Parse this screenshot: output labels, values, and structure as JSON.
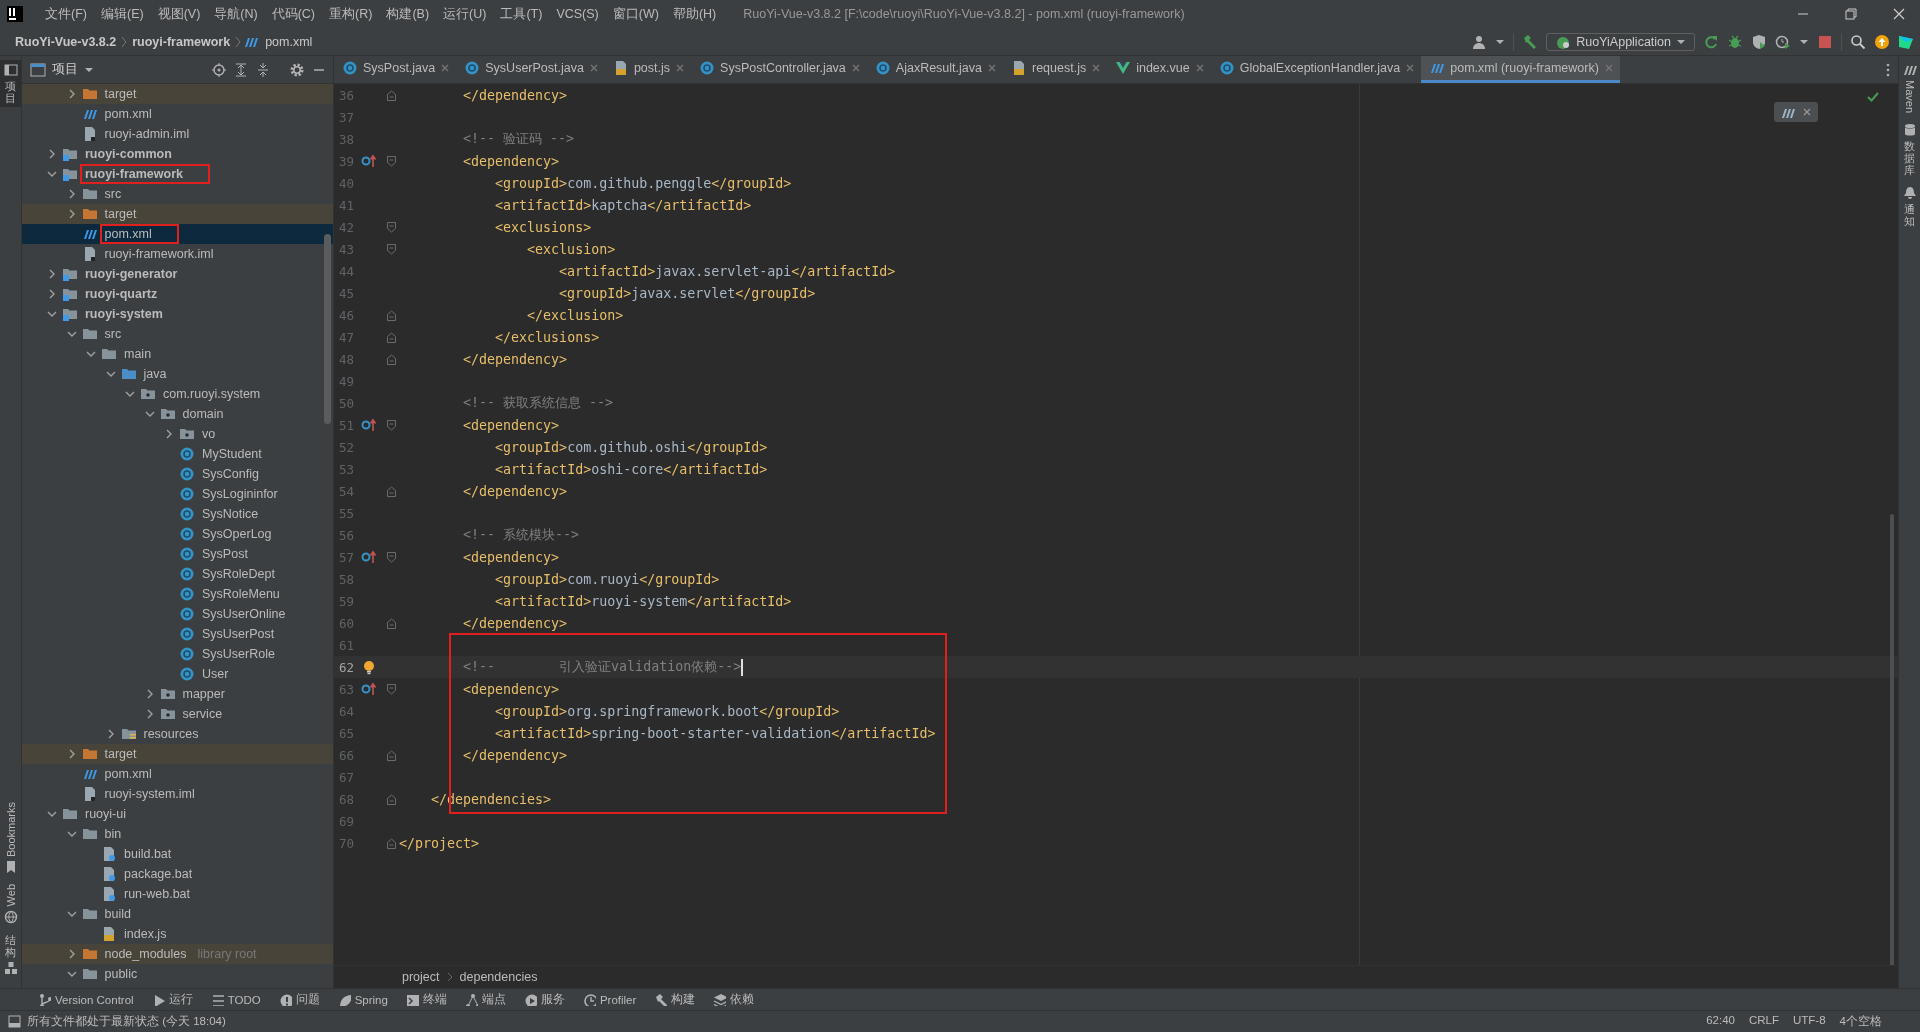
{
  "window_title": "RuoYi-Vue-v3.8.2 [F:\\code\\ruoyi\\RuoYi-Vue-v3.8.2] - pom.xml (ruoyi-framework)",
  "menu": [
    "文件(F)",
    "编辑(E)",
    "视图(V)",
    "导航(N)",
    "代码(C)",
    "重构(R)",
    "构建(B)",
    "运行(U)",
    "工具(T)",
    "VCS(S)",
    "窗口(W)",
    "帮助(H)"
  ],
  "breadcrumb": [
    {
      "label": "RuoYi-Vue-v3.8.2",
      "kind": "project"
    },
    {
      "label": "ruoyi-framework",
      "kind": "module"
    },
    {
      "label": "pom.xml",
      "kind": "maven_file"
    }
  ],
  "run_configuration": "RuoYiApplication",
  "left_strip": [
    {
      "label": "项目",
      "kind": "cjk",
      "selected": true
    },
    {
      "label": "Bookmarks",
      "kind": "latin",
      "selected": false
    },
    {
      "label": "Web",
      "kind": "latin",
      "selected": false
    },
    {
      "label": "结构",
      "kind": "cjk",
      "selected": false
    }
  ],
  "right_strip": [
    {
      "label": "Maven",
      "kind": "latin"
    },
    {
      "label": "数据库",
      "kind": "cjk"
    },
    {
      "label": "通知",
      "kind": "cjk"
    }
  ],
  "project_panel": {
    "title": "项目",
    "tree": {
      "continued_children": [
        {
          "label": "target",
          "kind": "excluded",
          "expanded": false,
          "selected": false
        },
        {
          "label": "pom.xml",
          "kind": "maven_file",
          "selected": false
        },
        {
          "label": "ruoyi-admin.iml",
          "kind": "iml",
          "selected": false
        }
      ],
      "items": [
        {
          "label": "ruoyi-common",
          "kind": "maven_module",
          "expanded": false,
          "selected": false
        },
        {
          "label": "ruoyi-framework",
          "kind": "maven_module",
          "expanded": true,
          "selected": false,
          "annotated": true,
          "children": [
            {
              "label": "src",
              "kind": "folder",
              "expanded": false,
              "selected": false
            },
            {
              "label": "target",
              "kind": "excluded",
              "expanded": false,
              "selected": false
            },
            {
              "label": "pom.xml",
              "kind": "maven_file",
              "selected": true,
              "annotated": true
            },
            {
              "label": "ruoyi-framework.iml",
              "kind": "iml",
              "selected": false
            }
          ]
        },
        {
          "label": "ruoyi-generator",
          "kind": "maven_module",
          "expanded": false,
          "selected": false
        },
        {
          "label": "ruoyi-quartz",
          "kind": "maven_module",
          "expanded": false,
          "selected": false
        },
        {
          "label": "ruoyi-system",
          "kind": "maven_module",
          "expanded": true,
          "selected": false,
          "children": [
            {
              "label": "src",
              "kind": "folder",
              "expanded": true,
              "selected": false,
              "children": [
                {
                  "label": "main",
                  "kind": "folder",
                  "expanded": true,
                  "selected": false,
                  "children": [
                    {
                      "label": "java",
                      "kind": "source_root",
                      "expanded": true,
                      "selected": false,
                      "children": [
                        {
                          "label": "com.ruoyi.system",
                          "kind": "package",
                          "expanded": true,
                          "selected": false,
                          "children": [
                            {
                              "label": "domain",
                              "kind": "package",
                              "expanded": true,
                              "selected": false,
                              "children": [
                                {
                                  "label": "vo",
                                  "kind": "package",
                                  "expanded": false,
                                  "selected": false
                                },
                                {
                                  "label": "MyStudent",
                                  "kind": "class",
                                  "selected": false
                                },
                                {
                                  "label": "SysConfig",
                                  "kind": "class",
                                  "selected": false
                                },
                                {
                                  "label": "SysLogininfor",
                                  "kind": "class",
                                  "selected": false
                                },
                                {
                                  "label": "SysNotice",
                                  "kind": "class",
                                  "selected": false
                                },
                                {
                                  "label": "SysOperLog",
                                  "kind": "class",
                                  "selected": false
                                },
                                {
                                  "label": "SysPost",
                                  "kind": "class",
                                  "selected": false
                                },
                                {
                                  "label": "SysRoleDept",
                                  "kind": "class",
                                  "selected": false
                                },
                                {
                                  "label": "SysRoleMenu",
                                  "kind": "class",
                                  "selected": false
                                },
                                {
                                  "label": "SysUserOnline",
                                  "kind": "class",
                                  "selected": false
                                },
                                {
                                  "label": "SysUserPost",
                                  "kind": "class",
                                  "selected": false
                                },
                                {
                                  "label": "SysUserRole",
                                  "kind": "class",
                                  "selected": false
                                },
                                {
                                  "label": "User",
                                  "kind": "class",
                                  "selected": false
                                }
                              ]
                            },
                            {
                              "label": "mapper",
                              "kind": "package",
                              "expanded": false,
                              "selected": false
                            },
                            {
                              "label": "service",
                              "kind": "package",
                              "expanded": false,
                              "selected": false
                            }
                          ]
                        }
                      ]
                    },
                    {
                      "label": "resources",
                      "kind": "resources",
                      "expanded": false,
                      "selected": false
                    }
                  ]
                }
              ]
            },
            {
              "label": "target",
              "kind": "excluded",
              "expanded": false,
              "selected": false
            },
            {
              "label": "pom.xml",
              "kind": "maven_file",
              "selected": false
            },
            {
              "label": "ruoyi-system.iml",
              "kind": "iml",
              "selected": false
            }
          ]
        },
        {
          "label": "ruoyi-ui",
          "kind": "folder",
          "expanded": true,
          "selected": false,
          "children": [
            {
              "label": "bin",
              "kind": "folder",
              "expanded": true,
              "selected": false,
              "children": [
                {
                  "label": "build.bat",
                  "kind": "bat",
                  "selected": false
                },
                {
                  "label": "package.bat",
                  "kind": "bat",
                  "selected": false
                },
                {
                  "label": "run-web.bat",
                  "kind": "bat",
                  "selected": false
                }
              ]
            },
            {
              "label": "build",
              "kind": "folder",
              "expanded": true,
              "selected": false,
              "children": [
                {
                  "label": "index.js",
                  "kind": "js",
                  "selected": false
                }
              ]
            },
            {
              "label": "node_modules",
              "kind": "excluded",
              "expanded": false,
              "selected": false,
              "hint": "library root"
            },
            {
              "label": "public",
              "kind": "folder",
              "expanded": true,
              "selected": false
            }
          ]
        }
      ]
    }
  },
  "editor": {
    "tabs": [
      {
        "label": "SysPost.java",
        "kind": "class",
        "selected": false
      },
      {
        "label": "SysUserPost.java",
        "kind": "class",
        "selected": false
      },
      {
        "label": "post.js",
        "kind": "js",
        "selected": false
      },
      {
        "label": "SysPostController.java",
        "kind": "class",
        "selected": false
      },
      {
        "label": "AjaxResult.java",
        "kind": "class",
        "selected": false
      },
      {
        "label": "request.js",
        "kind": "js",
        "selected": false
      },
      {
        "label": "index.vue",
        "kind": "vue",
        "selected": false
      },
      {
        "label": "GlobalExceptionHandler.java",
        "kind": "class",
        "selected": false
      },
      {
        "label": "pom.xml (ruoyi-framework)",
        "kind": "maven_file",
        "selected": true
      }
    ],
    "lines_before": [
      {
        "number": "36",
        "code": "        </dependency>",
        "kind": "xml",
        "fold_end": true
      },
      {
        "number": "37"
      },
      {
        "number": "38",
        "code": "        <!-- 验证码 -->",
        "kind": "comment"
      },
      {
        "number": "39",
        "code": "        <dependency>",
        "kind": "xml",
        "fold_start": true,
        "dependency_marker": true
      },
      {
        "number": "40",
        "code": "            <groupId>com.github.penggle</groupId>",
        "kind": "xml"
      },
      {
        "number": "41",
        "code": "            <artifactId>kaptcha</artifactId>",
        "kind": "xml"
      },
      {
        "number": "42",
        "code": "            <exclusions>",
        "kind": "xml",
        "fold_start": true
      },
      {
        "number": "43",
        "code": "                <exclusion>",
        "kind": "xml",
        "fold_start": true
      },
      {
        "number": "44",
        "code": "                    <artifactId>javax.servlet-api</artifactId>",
        "kind": "xml"
      },
      {
        "number": "45",
        "code": "                    <groupId>javax.servlet</groupId>",
        "kind": "xml"
      },
      {
        "number": "46",
        "code": "                </exclusion>",
        "kind": "xml",
        "fold_end": true
      },
      {
        "number": "47",
        "code": "            </exclusions>",
        "kind": "xml",
        "fold_end": true
      },
      {
        "number": "48",
        "code": "        </dependency>",
        "kind": "xml",
        "fold_end": true
      },
      {
        "number": "49"
      },
      {
        "number": "50",
        "code": "        <!-- 获取系统信息 -->",
        "kind": "comment"
      },
      {
        "number": "51",
        "code": "        <dependency>",
        "kind": "xml",
        "fold_start": true,
        "dependency_marker": true
      },
      {
        "number": "52",
        "code": "            <groupId>com.github.oshi</groupId>",
        "kind": "xml"
      },
      {
        "number": "53",
        "code": "            <artifactId>oshi-core</artifactId>",
        "kind": "xml"
      },
      {
        "number": "54",
        "code": "        </dependency>",
        "kind": "xml",
        "fold_end": true
      },
      {
        "number": "55"
      },
      {
        "number": "56",
        "code": "        <!-- 系统模块-->",
        "kind": "comment"
      },
      {
        "number": "57",
        "code": "        <dependency>",
        "kind": "xml",
        "fold_start": true,
        "dependency_marker": true
      },
      {
        "number": "58",
        "code": "            <groupId>com.ruoyi</groupId>",
        "kind": "xml"
      },
      {
        "number": "59",
        "code": "            <artifactId>ruoyi-system</artifactId>",
        "kind": "xml"
      },
      {
        "number": "60",
        "code": "        </dependency>",
        "kind": "xml",
        "fold_end": true
      }
    ],
    "highlighted_block": {
      "boxed": true,
      "lines": [
        {
          "number": "61"
        },
        {
          "number": "62",
          "code": "        <!--        引入验证validation依赖-->",
          "kind": "comment",
          "bulb": true,
          "current": true,
          "caret": true
        },
        {
          "number": "63",
          "code": "        <dependency>",
          "kind": "xml",
          "fold_start": true,
          "dependency_marker": true
        },
        {
          "number": "64",
          "code": "            <groupId>org.springframework.boot</groupId>",
          "kind": "xml"
        },
        {
          "number": "65",
          "code": "            <artifactId>spring-boot-starter-validation</artifactId>",
          "kind": "xml"
        },
        {
          "number": "66",
          "code": "        </dependency>",
          "kind": "xml",
          "fold_end": true
        },
        {
          "number": "67"
        },
        {
          "number": "68",
          "code": "    </dependencies>",
          "kind": "xml",
          "fold_end": true
        }
      ]
    },
    "lines_after": [
      {
        "number": "69"
      },
      {
        "number": "70",
        "code": "</project>",
        "kind": "xml",
        "fold_end": true
      }
    ],
    "breadcrumb": [
      "project",
      "dependencies"
    ]
  },
  "tool_windows": [
    {
      "label": "Version Control",
      "kind": "branch"
    },
    {
      "label": "运行",
      "kind": "run"
    },
    {
      "label": "TODO",
      "kind": "list"
    },
    {
      "label": "问题",
      "kind": "problems"
    },
    {
      "label": "Spring",
      "kind": "leaf"
    },
    {
      "label": "终端",
      "kind": "terminal"
    },
    {
      "label": "端点",
      "kind": "endpoints"
    },
    {
      "label": "服务",
      "kind": "services"
    },
    {
      "label": "Profiler",
      "kind": "profiler"
    },
    {
      "label": "构建",
      "kind": "build"
    },
    {
      "label": "依赖",
      "kind": "deps"
    }
  ],
  "status_bar": {
    "message": "所有文件都处于最新状态 (今天 18:04)",
    "position": "62:40",
    "line_separator": "CRLF",
    "encoding": "UTF-8",
    "indent": "4个空格"
  }
}
